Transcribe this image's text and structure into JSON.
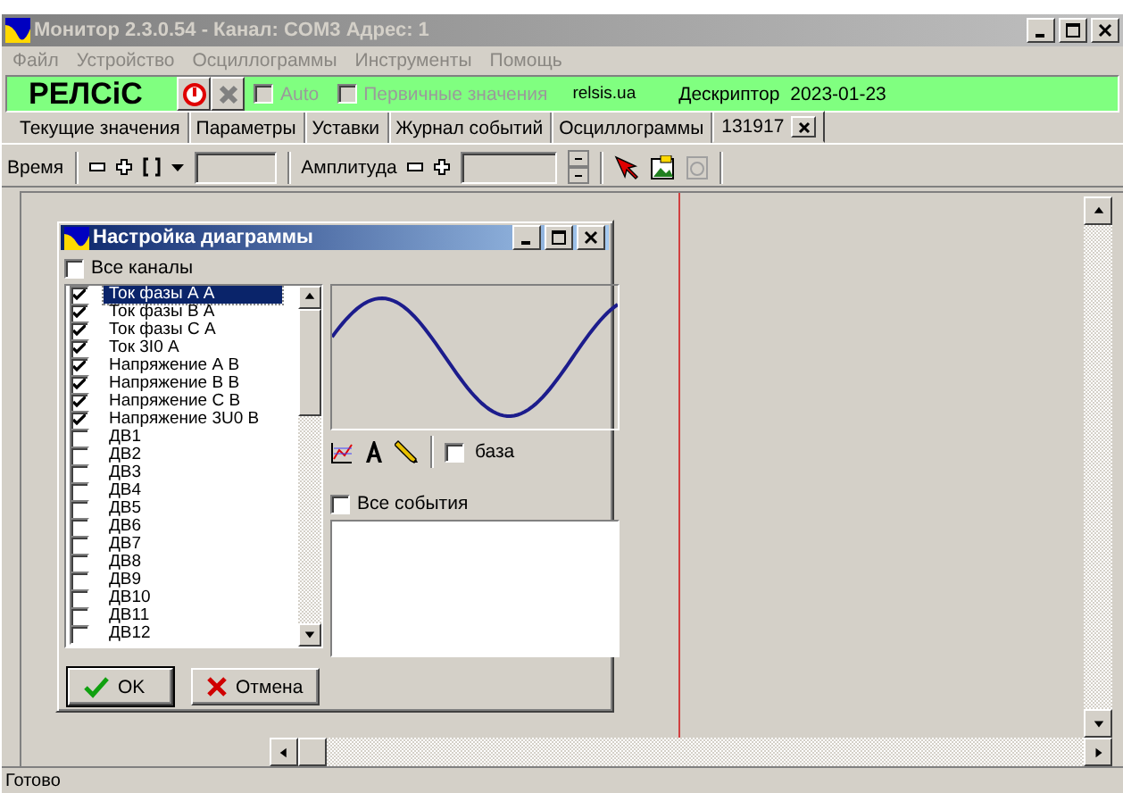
{
  "window": {
    "title": "Монитор 2.3.0.54 - Канал: COM3  Адрес: 1",
    "active": false
  },
  "menu": [
    {
      "label": "Файл",
      "disabled": true
    },
    {
      "label": "Устройство",
      "disabled": true
    },
    {
      "label": "Осциллограммы",
      "disabled": true
    },
    {
      "label": "Инструменты",
      "disabled": true
    },
    {
      "label": "Помощь",
      "disabled": true
    }
  ],
  "brand_bar": {
    "logo": "РЕЛСіС",
    "auto": {
      "label": "Auto",
      "checked": false,
      "disabled": true
    },
    "primary": {
      "label": "Первичные значения",
      "checked": false,
      "disabled": true
    },
    "site": "relsis.ua",
    "descriptor_label": "Дескриптор",
    "descriptor_value": "2023-01-23"
  },
  "tabs": [
    {
      "label": "Текущие значения",
      "selected": false,
      "closable": false
    },
    {
      "label": "Параметры",
      "selected": false,
      "closable": false
    },
    {
      "label": "Уставки",
      "selected": false,
      "closable": false
    },
    {
      "label": "Журнал событий",
      "selected": false,
      "closable": false
    },
    {
      "label": "Осциллограммы",
      "selected": false,
      "closable": false
    },
    {
      "label": "131917",
      "selected": true,
      "closable": true
    }
  ],
  "toolbar": {
    "time_label": "Время",
    "amplitude_label": "Амплитуда"
  },
  "dialog": {
    "title": "Настройка диаграммы",
    "all_channels": {
      "label": "Все каналы",
      "checked": false
    },
    "channels": [
      {
        "label": "Ток фазы А А",
        "checked": true,
        "selected": true
      },
      {
        "label": "Ток фазы В А",
        "checked": true,
        "selected": false
      },
      {
        "label": "Ток фазы С А",
        "checked": true,
        "selected": false
      },
      {
        "label": "Ток 3I0 А",
        "checked": true,
        "selected": false
      },
      {
        "label": "Напряжение А В",
        "checked": true,
        "selected": false
      },
      {
        "label": "Напряжение В В",
        "checked": true,
        "selected": false
      },
      {
        "label": "Напряжение С В",
        "checked": true,
        "selected": false
      },
      {
        "label": "Напряжение 3U0 В",
        "checked": true,
        "selected": false
      },
      {
        "label": "ДВ1",
        "checked": false,
        "selected": false
      },
      {
        "label": "ДВ2",
        "checked": false,
        "selected": false
      },
      {
        "label": "ДВ3",
        "checked": false,
        "selected": false
      },
      {
        "label": "ДВ4",
        "checked": false,
        "selected": false
      },
      {
        "label": "ДВ5",
        "checked": false,
        "selected": false
      },
      {
        "label": "ДВ6",
        "checked": false,
        "selected": false
      },
      {
        "label": "ДВ7",
        "checked": false,
        "selected": false
      },
      {
        "label": "ДВ8",
        "checked": false,
        "selected": false
      },
      {
        "label": "ДВ9",
        "checked": false,
        "selected": false
      },
      {
        "label": "ДВ10",
        "checked": false,
        "selected": false
      },
      {
        "label": "ДВ11",
        "checked": false,
        "selected": false
      },
      {
        "label": "ДВ12",
        "checked": false,
        "selected": false
      }
    ],
    "base": {
      "label": "база",
      "checked": false
    },
    "all_events": {
      "label": "Все события",
      "checked": false
    },
    "ok": "OK",
    "cancel": "Отмена"
  },
  "status_bar": "Готово"
}
